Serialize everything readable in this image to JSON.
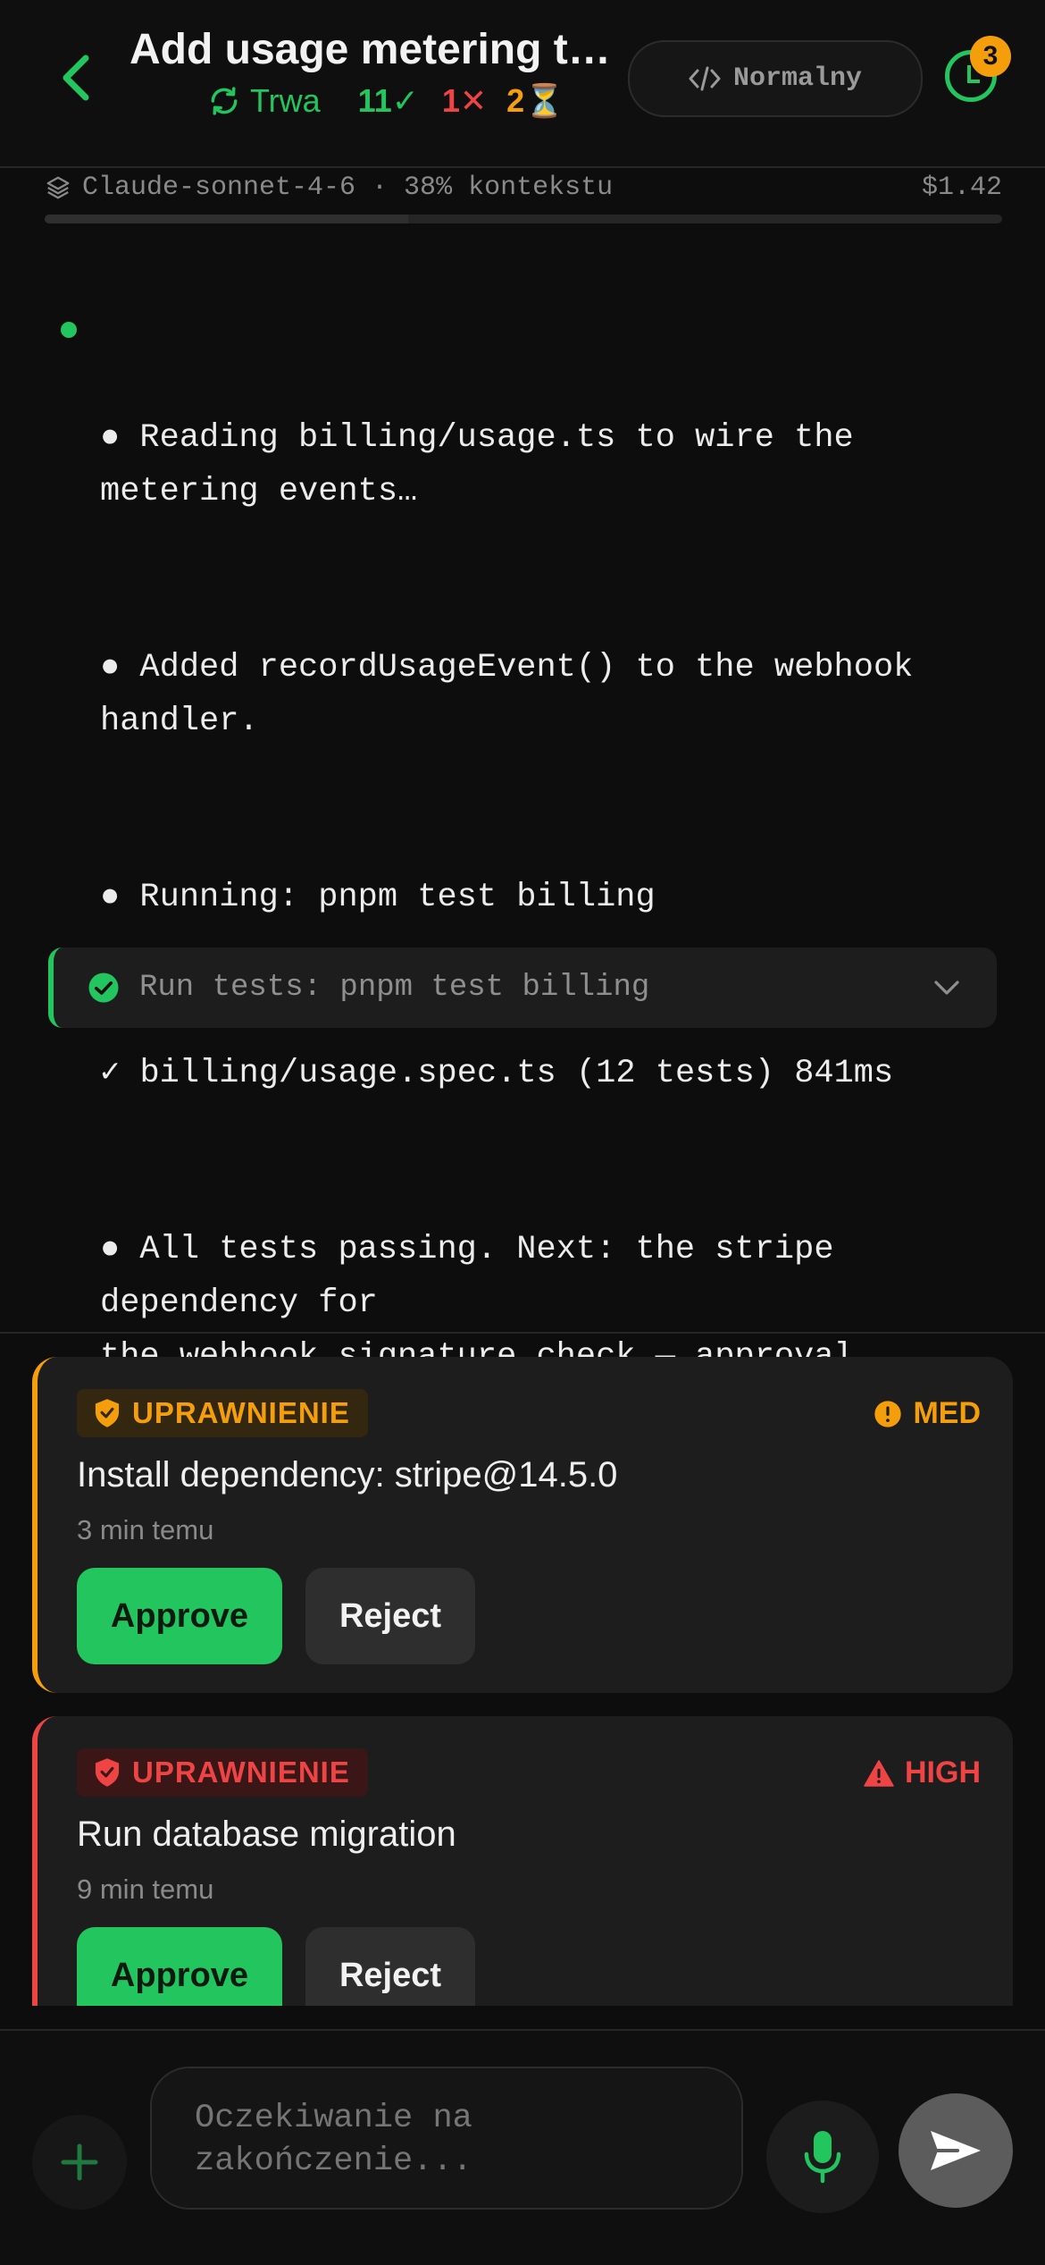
{
  "header": {
    "title": "Add usage metering to…",
    "status_label": "Trwa",
    "count_ok": "11✓",
    "count_fail": "1✕",
    "count_pending": "2⏳",
    "mode_label": "Normalny",
    "history_badge": "3"
  },
  "model": {
    "label": "Claude-sonnet-4-6 · 38% kontekstu",
    "cost": "$1.42",
    "context_used_fraction": 0.38
  },
  "stream": {
    "lines": [
      "● Reading billing/usage.ts to wire the metering events…",
      "● Added recordUsageEvent() to the webhook handler.",
      "● Running: pnpm test billing",
      "✓ billing/usage.spec.ts (12 tests) 841ms",
      "● All tests passing. Next: the stripe dependency for\nthe webhook signature check — approval pending."
    ]
  },
  "tool_card": {
    "label": "Run tests: pnpm test billing"
  },
  "approvals": [
    {
      "tag": "UPRAWNIENIE",
      "risk": "MED",
      "title": "Install dependency: stripe@14.5.0",
      "time": "3 min temu",
      "approve_label": "Approve",
      "reject_label": "Reject"
    },
    {
      "tag": "UPRAWNIENIE",
      "risk": "HIGH",
      "title": "Run database migration",
      "time": "9 min temu",
      "approve_label": "Approve",
      "reject_label": "Reject"
    }
  ],
  "composer": {
    "placeholder": "Oczekiwanie na zakończenie..."
  },
  "icons": {
    "back": "chevron-left-icon",
    "status": "refresh-icon",
    "mode": "code-icon",
    "history": "clock-icon",
    "model": "layers-icon",
    "tool_ok": "check-circle-icon",
    "expand": "chevron-down-icon",
    "tag": "shield-icon",
    "risk_med": "alert-circle-icon",
    "risk_high": "warning-triangle-icon",
    "attach": "plus-icon",
    "mic": "microphone-icon",
    "send": "send-icon"
  },
  "colors": {
    "accent": "#22c55e",
    "warning": "#f59e0b",
    "danger": "#ef4444",
    "background": "#0d0d0d"
  }
}
